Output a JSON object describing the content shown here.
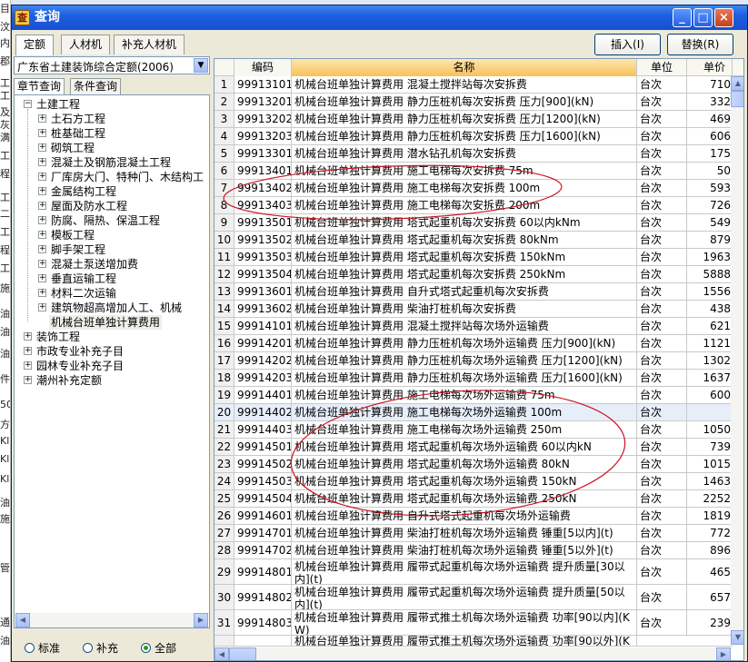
{
  "bg_text": [
    "目",
    "汶",
    "内",
    "郡",
    "工",
    "工",
    "及",
    "灰",
    "满",
    "工",
    "程",
    "工",
    "二",
    "工",
    "程",
    "工",
    "施",
    "油",
    "油",
    "油",
    "件",
    "50",
    "方",
    "Kl",
    "Kl",
    "Kl",
    "油",
    "施",
    "管",
    "通",
    "油"
  ],
  "window": {
    "title": "查询",
    "icon": "查"
  },
  "tabs": [
    "定额",
    "人材机",
    "补充人材机"
  ],
  "buttons": {
    "insert": "插入(I)",
    "replace": "替换(R)"
  },
  "quota_select": {
    "value": "广东省土建装饰综合定额(2006)"
  },
  "left_tabs": [
    "章节查询",
    "条件查询"
  ],
  "tree": {
    "root": "土建工程",
    "children": [
      "土石方工程",
      "桩基础工程",
      "砌筑工程",
      "混凝土及钢筋混凝土工程",
      "厂库房大门、特种门、木结构工",
      "金属结构工程",
      "屋面及防水工程",
      "防腐、隔热、保温工程",
      "模板工程",
      "脚手架工程",
      "混凝土泵送增加费",
      "垂直运输工程",
      "材料二次运输",
      "建筑物超高增加人工、机械",
      "机械台班单独计算费用"
    ],
    "others": [
      "装饰工程",
      "市政专业补充子目",
      "园林专业补充子目",
      "潮州补充定额"
    ]
  },
  "filter": {
    "options": [
      "标准",
      "补充",
      "全部"
    ],
    "selected": 2
  },
  "grid": {
    "columns": [
      "",
      "编码",
      "名称",
      "单位",
      "单价"
    ],
    "selected_row": 20,
    "rows": [
      [
        "1",
        "99913101",
        "机械台班单独计算费用 混凝土搅拌站每次安拆费",
        "台次",
        "710"
      ],
      [
        "2",
        "99913201",
        "机械台班单独计算费用 静力压桩机每次安拆费 压力[900](kN)",
        "台次",
        "332"
      ],
      [
        "3",
        "99913202",
        "机械台班单独计算费用 静力压桩机每次安拆费 压力[1200](kN)",
        "台次",
        "469"
      ],
      [
        "4",
        "99913203",
        "机械台班单独计算费用 静力压桩机每次安拆费 压力[1600](kN)",
        "台次",
        "606"
      ],
      [
        "5",
        "99913301",
        "机械台班单独计算费用 潜水钻孔机每次安拆费",
        "台次",
        "175"
      ],
      [
        "6",
        "99913401",
        "机械台班单独计算费用 施工电梯每次安拆费 75m",
        "台次",
        "50"
      ],
      [
        "7",
        "99913402",
        "机械台班单独计算费用 施工电梯每次安拆费 100m",
        "台次",
        "593"
      ],
      [
        "8",
        "99913403",
        "机械台班单独计算费用 施工电梯每次安拆费 200m",
        "台次",
        "726"
      ],
      [
        "9",
        "99913501",
        "机械台班单独计算费用 塔式起重机每次安拆费 60以内kNm",
        "台次",
        "549"
      ],
      [
        "10",
        "99913502",
        "机械台班单独计算费用 塔式起重机每次安拆费 80kNm",
        "台次",
        "879"
      ],
      [
        "11",
        "99913503",
        "机械台班单独计算费用 塔式起重机每次安拆费 150kNm",
        "台次",
        "1963"
      ],
      [
        "12",
        "99913504",
        "机械台班单独计算费用 塔式起重机每次安拆费 250kNm",
        "台次",
        "5888"
      ],
      [
        "13",
        "99913601",
        "机械台班单独计算费用 自升式塔式起重机每次安拆费",
        "台次",
        "1556"
      ],
      [
        "14",
        "99913602",
        "机械台班单独计算费用 柴油打桩机每次安拆费",
        "台次",
        "438"
      ],
      [
        "15",
        "99914101",
        "机械台班单独计算费用 混凝土搅拌站每次场外运输费",
        "台次",
        "621"
      ],
      [
        "16",
        "99914201",
        "机械台班单独计算费用 静力压桩机每次场外运输费 压力[900](kN)",
        "台次",
        "1121"
      ],
      [
        "17",
        "99914202",
        "机械台班单独计算费用 静力压桩机每次场外运输费 压力[1200](kN)",
        "台次",
        "1302"
      ],
      [
        "18",
        "99914203",
        "机械台班单独计算费用 静力压桩机每次场外运输费 压力[1600](kN)",
        "台次",
        "1637"
      ],
      [
        "19",
        "99914401",
        "机械台班单独计算费用 施工电梯每次场外运输费 75m",
        "台次",
        "600"
      ],
      [
        "20",
        "99914402",
        "机械台班单独计算费用 施工电梯每次场外运输费 100m",
        "台次",
        ""
      ],
      [
        "21",
        "99914403",
        "机械台班单独计算费用 施工电梯每次场外运输费 250m",
        "台次",
        "1050"
      ],
      [
        "22",
        "99914501",
        "机械台班单独计算费用 塔式起重机每次场外运输费 60以内kN",
        "台次",
        "739"
      ],
      [
        "23",
        "99914502",
        "机械台班单独计算费用 塔式起重机每次场外运输费 80kN",
        "台次",
        "1015"
      ],
      [
        "24",
        "99914503",
        "机械台班单独计算费用 塔式起重机每次场外运输费 150kN",
        "台次",
        "1463"
      ],
      [
        "25",
        "99914504",
        "机械台班单独计算费用 塔式起重机每次场外运输费 250kN",
        "台次",
        "2252"
      ],
      [
        "26",
        "99914601",
        "机械台班单独计算费用 自升式塔式起重机每次场外运输费",
        "台次",
        "1819"
      ],
      [
        "27",
        "99914701",
        "机械台班单独计算费用 柴油打桩机每次场外运输费 锤重[5以内](t)",
        "台次",
        "772"
      ],
      [
        "28",
        "99914702",
        "机械台班单独计算费用 柴油打桩机每次场外运输费 锤重[5以外](t)",
        "台次",
        "896"
      ],
      [
        "29",
        "99914801",
        "机械台班单独计算费用 履带式起重机每次场外运输费 提升质量[30以内](t)",
        "台次",
        "465"
      ],
      [
        "30",
        "99914802",
        "机械台班单独计算费用 履带式起重机每次场外运输费 提升质量[50以内](t)",
        "台次",
        "657"
      ],
      [
        "31",
        "99914803",
        "机械台班单独计算费用 履带式推土机每次场外运输费 功率[90以内](KW)",
        "台次",
        "239"
      ]
    ],
    "partial_row": "机械台班单独计算费用 履带式推土机每次场外运输费 功率[90以外](K"
  },
  "colors": {
    "titlebar": "#1f5fe0",
    "header_name": "#f7c15c",
    "annotation": "#c8141e",
    "radio_on": "#21a121"
  }
}
